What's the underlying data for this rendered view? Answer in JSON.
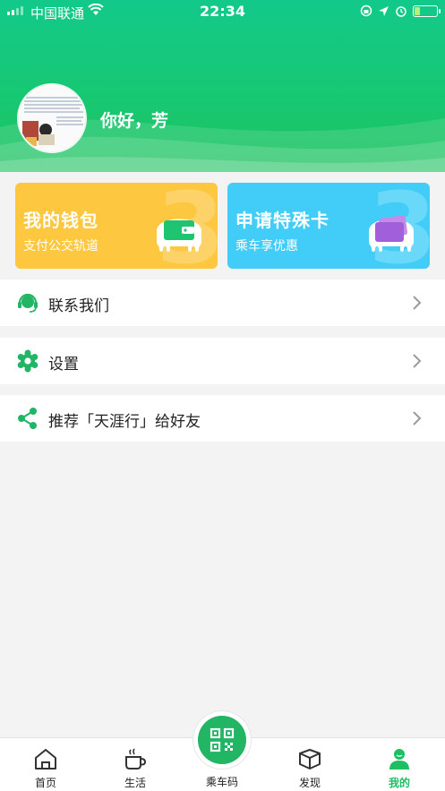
{
  "status_bar": {
    "carrier": "中国联通",
    "time": "22:34"
  },
  "profile": {
    "greeting": "你好，芳"
  },
  "cards": {
    "wallet": {
      "title": "我的钱包",
      "subtitle": "支付公交轨道",
      "color": "#fdc73f"
    },
    "special": {
      "title": "申请特殊卡",
      "subtitle": "乘车享优惠",
      "color": "#41cdf7"
    }
  },
  "menu": [
    {
      "label": "联系我们",
      "icon": "headset-icon"
    },
    {
      "label": "设置",
      "icon": "gear-icon"
    },
    {
      "label": "推荐「天涯行」给好友",
      "icon": "share-icon"
    }
  ],
  "nav": {
    "home": "首页",
    "life": "生活",
    "ride_code": "乘车码",
    "discover": "发现",
    "mine": "我的",
    "active": "mine"
  },
  "colors": {
    "brand_green": "#1dbf63",
    "header_top": "#12c98a",
    "wallet_yellow": "#fdc73f",
    "special_blue": "#41cdf7"
  }
}
